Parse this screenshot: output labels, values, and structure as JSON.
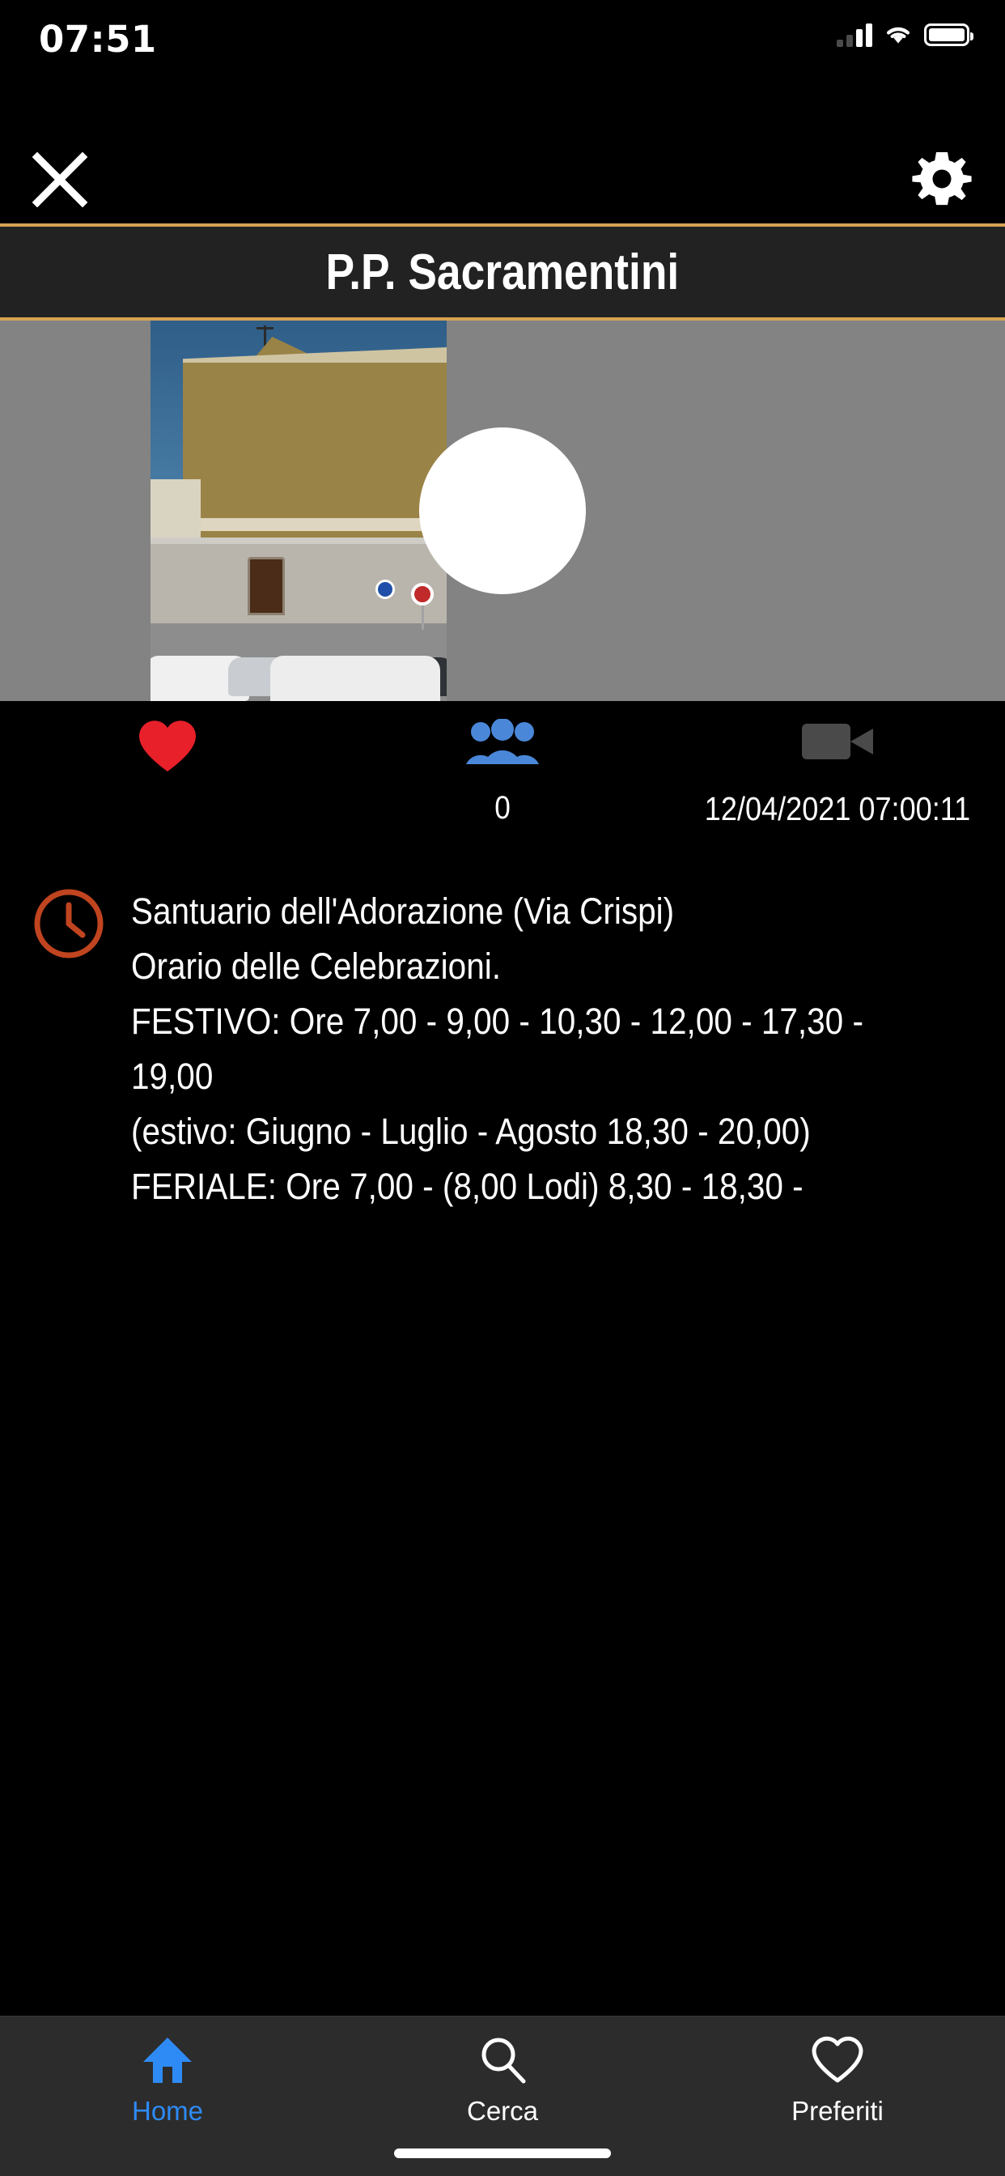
{
  "status_bar": {
    "time": "07:51",
    "signal_icon": "cellular-signal-icon",
    "wifi_icon": "wifi-icon",
    "battery_icon": "battery-icon"
  },
  "top_bar": {
    "close_icon": "close-icon",
    "settings_icon": "gear-icon",
    "divider_color": "#d8a253"
  },
  "header": {
    "title": "P.P. Sacramentini",
    "background": "#222222"
  },
  "media": {
    "type": "video-thumbnail",
    "play_icon": "play-icon",
    "backdrop_color": "#838383"
  },
  "stats": {
    "favorite_icon": "heart-filled-icon",
    "favorite_color": "#e8202a",
    "viewers_icon": "people-icon",
    "viewers_color": "#4a87d8",
    "video_icon": "video-camera-icon",
    "video_color": "#4a4a4a",
    "viewers_count": "0",
    "timestamp": "12/04/2021 07:00:11"
  },
  "description": {
    "clock_icon": "clock-icon",
    "clock_color": "#c0441f",
    "text": "Santuario dell'Adorazione (Via Crispi)\nOrario delle Celebrazioni.\nFESTIVO: Ore 7,00 - 9,00 - 10,30 - 12,00 - 17,30 - 19,00\n(estivo: Giugno - Luglio - Agosto 18,30 - 20,00)\nFERIALE: Ore 7,00 - (8,00 Lodi) 8,30 - 18,30 -"
  },
  "tab_bar": {
    "active_color": "#2e8bf5",
    "inactive_color": "#ffffff",
    "tabs": [
      {
        "label": "Home",
        "icon": "home-icon",
        "active": true
      },
      {
        "label": "Cerca",
        "icon": "search-icon",
        "active": false
      },
      {
        "label": "Preferiti",
        "icon": "heart-outline-icon",
        "active": false
      }
    ]
  }
}
